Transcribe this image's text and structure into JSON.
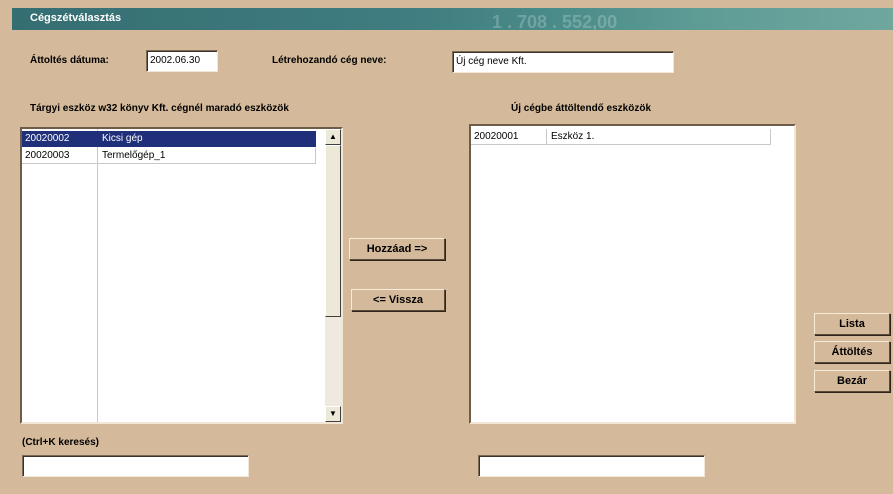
{
  "window": {
    "title": "Cégszétválasztás",
    "title_decoration": "1 . 708 . 552,00"
  },
  "form": {
    "transfer_date_label": "Áttoltés dátuma:",
    "transfer_date_value": "2002.06.30",
    "company_name_label": "Létrehozandó cég neve:",
    "company_name_value": "Új cég neve Kft."
  },
  "left_list": {
    "caption": "Tárgyi eszköz w32 könyv Kft. cégnél maradó eszközök",
    "rows": [
      {
        "code": "20020002",
        "name": "Kicsi gép",
        "selected": true
      },
      {
        "code": "20020003",
        "name": "Termelőgép_1",
        "selected": false
      }
    ]
  },
  "right_list": {
    "caption": "Új cégbe áttöltendő eszközök",
    "rows": [
      {
        "code": "20020001",
        "name": "Eszköz 1."
      }
    ]
  },
  "buttons": {
    "add": "Hozzáad =>",
    "back": "<= Vissza",
    "list": "Lista",
    "transfer": "Áttöltés",
    "close": "Bezár"
  },
  "search": {
    "hint": "(Ctrl+K keresés)",
    "left_value": "",
    "right_value": ""
  },
  "icons": {
    "scroll_up": "scroll-up-arrow-icon",
    "scroll_down": "scroll-down-arrow-icon"
  },
  "colors": {
    "background": "#d4b99a",
    "title_bar": "#3f7d80",
    "selection": "#1f2f7a"
  }
}
